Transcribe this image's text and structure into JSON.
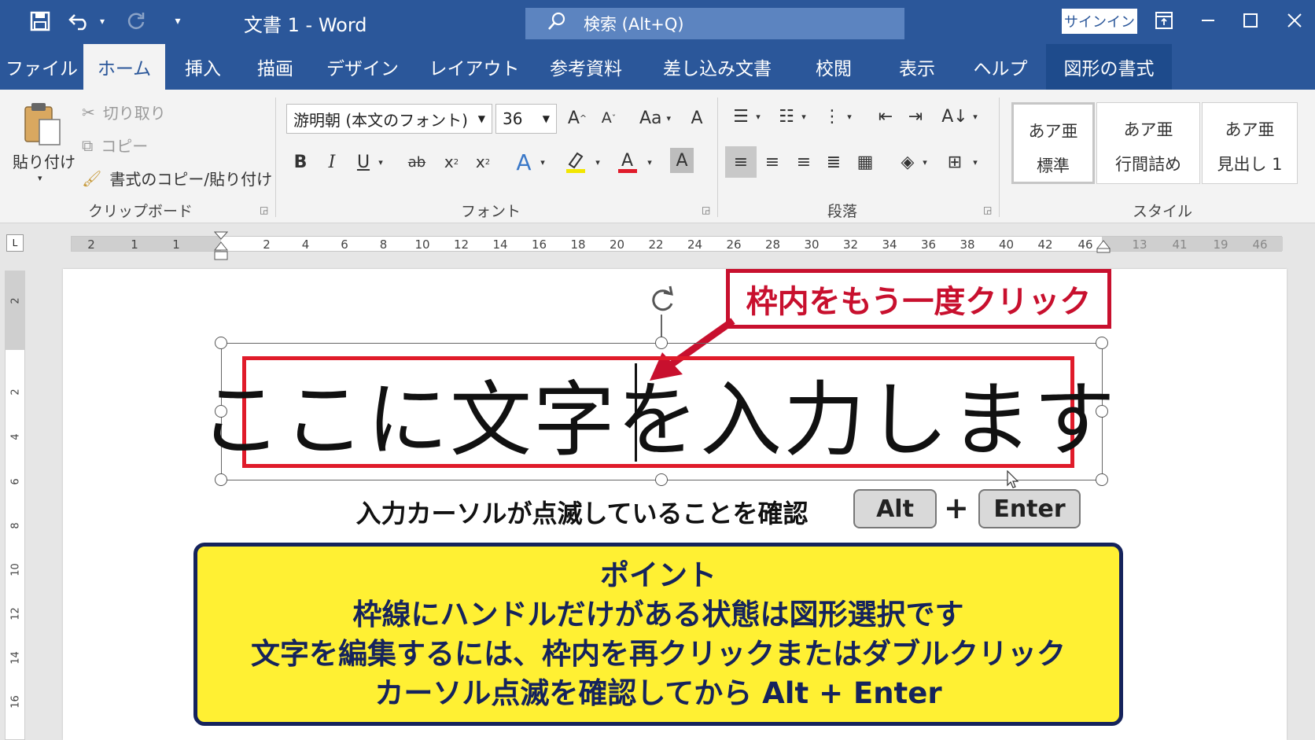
{
  "title_bar": {
    "document_title": "文書 1  -  Word",
    "search_placeholder": "検索 (Alt+Q)",
    "signin_label": "サインイン",
    "icons": [
      "save-icon",
      "undo-icon",
      "redo-icon",
      "customize-icon",
      "search-icon",
      "ribbon-display-icon",
      "minimize-icon",
      "maximize-icon",
      "close-icon"
    ]
  },
  "tabs": [
    "ファイル",
    "ホーム",
    "挿入",
    "描画",
    "デザイン",
    "レイアウト",
    "参考資料",
    "差し込み文書",
    "校閲",
    "表示",
    "ヘルプ",
    "図形の書式"
  ],
  "active_tab": "ホーム",
  "ribbon": {
    "clipboard": {
      "paste_label": "貼り付け",
      "cut_label": "切り取り",
      "copy_label": "コピー",
      "format_painter_label": "書式のコピー/貼り付け",
      "group_label": "クリップボード"
    },
    "font": {
      "font_name": "游明朝 (本文のフォント)",
      "font_size": "36",
      "case_label": "Aa",
      "group_label": "フォント"
    },
    "paragraph": {
      "group_label": "段落"
    },
    "styles": {
      "items": [
        {
          "sample": "あア亜",
          "name": "標準"
        },
        {
          "sample": "あア亜",
          "name": "行間詰め"
        },
        {
          "sample": "あア亜",
          "name": "見出し 1"
        }
      ],
      "group_label": "スタイル"
    }
  },
  "ruler": {
    "left_numbers": [
      "2",
      "1",
      "1"
    ],
    "numbers": [
      "2",
      "4",
      "6",
      "8",
      "10",
      "12",
      "14",
      "16",
      "18",
      "20",
      "22",
      "24",
      "26",
      "28",
      "30",
      "32",
      "34",
      "36",
      "38",
      "40",
      "42",
      "46"
    ],
    "right_numbers": [
      "13",
      "41",
      "19",
      "46"
    ]
  },
  "vertical_ruler": [
    "2",
    "2",
    "4",
    "6",
    "8",
    "10",
    "12",
    "14",
    "16"
  ],
  "document": {
    "callout_text": "枠内をもう一度クリック",
    "textbox_text": "ここに文字を入力します",
    "caption": "入力カーソルが点滅していることを確認",
    "key_alt": "Alt",
    "key_plus": "+",
    "key_enter": "Enter",
    "point_title": "ポイント",
    "point_lines": [
      "枠線にハンドルだけがある状態は図形選択です",
      "文字を編集するには、枠内を再クリックまたはダブルクリック",
      "カーソル点滅を確認してから Alt + Enter"
    ]
  },
  "colors": {
    "title_bar": "#2b579a",
    "callout_red": "#c8102e",
    "textbox_border": "#e01b2a",
    "point_bg": "#fff033",
    "point_text": "#15235c"
  }
}
